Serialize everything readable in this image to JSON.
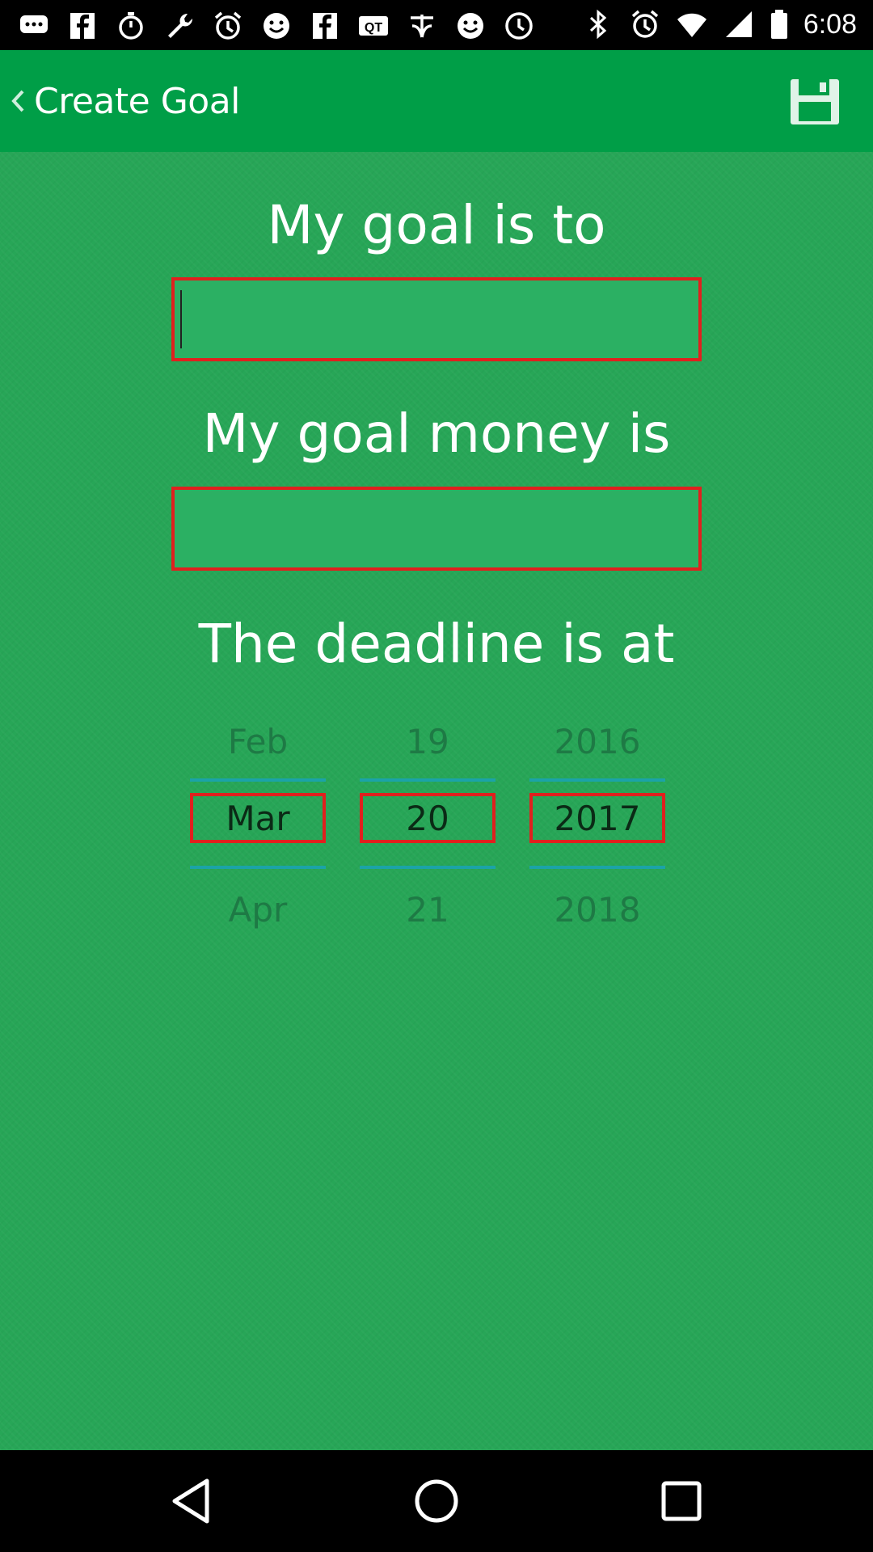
{
  "status_bar": {
    "time": "6:08",
    "icons": [
      "chat-icon",
      "facebook-icon",
      "timer-icon",
      "wrench-icon",
      "alarm-icon",
      "smiley-icon",
      "facebook-icon",
      "qt-icon",
      "tencent-icon",
      "smiley-icon",
      "clock-icon",
      "bluetooth-icon",
      "alarm-icon",
      "wifi-icon",
      "signal-icon",
      "battery-icon"
    ]
  },
  "app_bar": {
    "title": "Create Goal",
    "back_icon": "chevron-left-icon",
    "save_icon": "save-icon"
  },
  "form": {
    "goal_label": "My goal is to",
    "goal_value": "",
    "money_label": "My goal money is",
    "money_value": "",
    "deadline_label": "The deadline is at"
  },
  "date_picker": {
    "month": {
      "prev": "Feb",
      "selected": "Mar",
      "next": "Apr"
    },
    "day": {
      "prev": "19",
      "selected": "20",
      "next": "21"
    },
    "year": {
      "prev": "2016",
      "selected": "2017",
      "next": "2018"
    }
  },
  "colors": {
    "app_bar": "#009E47",
    "background": "#27A657",
    "field_border": "#E0201E",
    "picker_divider": "#1BA3A8"
  },
  "nav_bar": {
    "icons": [
      "back-triangle-icon",
      "home-circle-icon",
      "recents-square-icon"
    ]
  }
}
